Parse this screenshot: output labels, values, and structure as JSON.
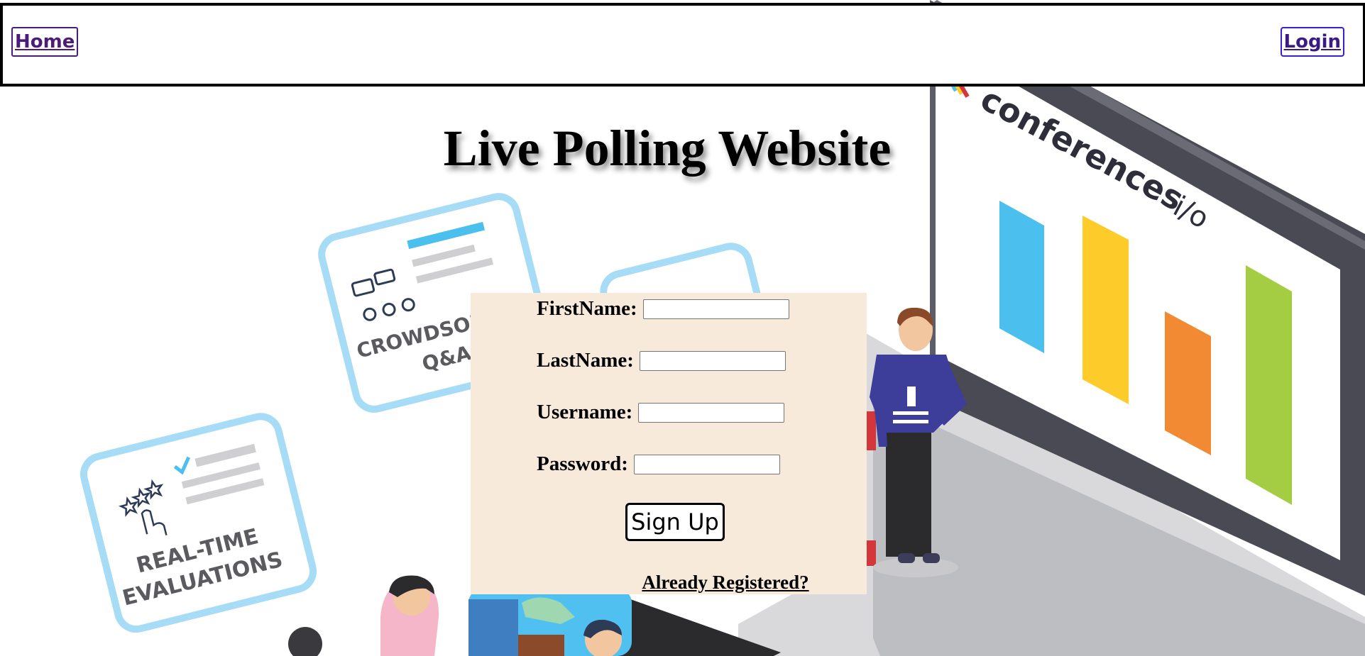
{
  "nav": {
    "home_label": "Home",
    "login_label": "Login"
  },
  "header": {
    "title": "Live Polling Website"
  },
  "illustration": {
    "card1_text": [
      "CROWDSOURCED",
      "Q&A"
    ],
    "card2_text": [
      "REAL-TIME",
      "EVALUATIONS"
    ],
    "screen_brand": "conferences",
    "screen_brand_suffix": "i/o"
  },
  "form": {
    "firstname_label": "FirstName:",
    "lastname_label": "LastName:",
    "username_label": "Username:",
    "password_label": "Password:",
    "firstname_value": "",
    "lastname_value": "",
    "username_value": "",
    "password_value": "",
    "signup_label": "Sign Up",
    "already_label": "Already Registered?"
  },
  "colors": {
    "form_bg": "#f8eadb",
    "bar_blue": "#4bbfee",
    "bar_yellow": "#fdcb2a",
    "bar_orange": "#f28a34",
    "bar_green": "#a5cd44",
    "card_border": "#a6dcf6"
  }
}
